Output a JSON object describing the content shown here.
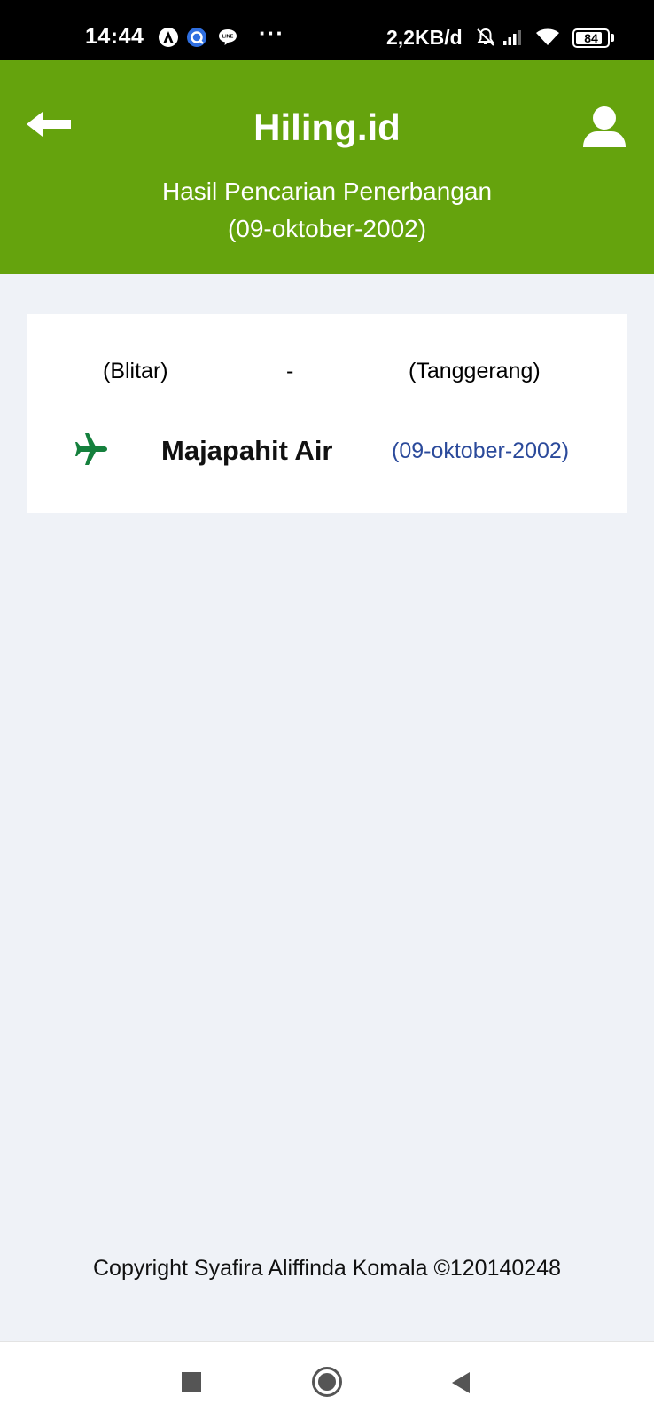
{
  "status_bar": {
    "time": "14:44",
    "network_speed": "2,2KB/d",
    "battery_level": "84",
    "battery_fraction": 0.84,
    "notification_icons": [
      "navigation-app-icon",
      "browser-app-icon",
      "line-app-icon"
    ],
    "more_indicator": "···",
    "system_icons": [
      "muted-bell-icon",
      "signal-icon",
      "wifi-icon",
      "battery-icon"
    ]
  },
  "header": {
    "title": "Hiling.id",
    "subtitle_line1": "Hasil Pencarian Penerbangan",
    "subtitle_line2": "(09-oktober-2002)",
    "background_color": "#65a30d",
    "left_icon": "back-arrow-icon",
    "right_icon": "user-profile-icon"
  },
  "result": {
    "origin": "(Blitar)",
    "separator": "-",
    "destination": "(Tanggerang)",
    "airline": "Majapahit Air",
    "date": "(09-oktober-2002)",
    "icon": "airplane-icon",
    "icon_color": "#15803d",
    "date_color": "#2b4a9b"
  },
  "footer": {
    "copyright": "Copyright Syafira Aliffinda Komala ©120140248"
  },
  "nav_bar": {
    "buttons": [
      "recent-apps",
      "home",
      "back"
    ]
  }
}
